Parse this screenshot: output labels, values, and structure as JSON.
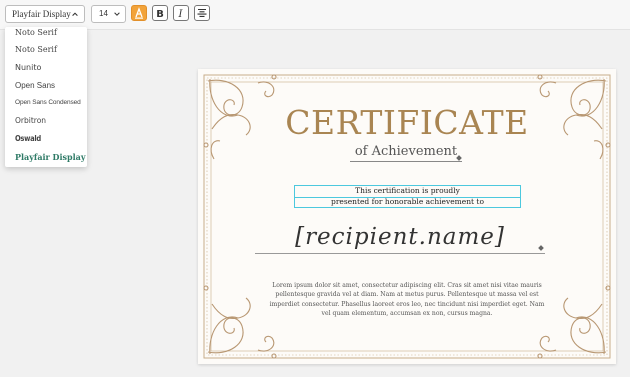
{
  "toolbar": {
    "font_select": {
      "value": "Playfair Display",
      "icon": "chevron-up-icon"
    },
    "size_select": {
      "value": "14",
      "icon": "chevron-down-icon"
    },
    "buttons": {
      "text_color": {
        "icon": "text-color-icon",
        "label": "A",
        "color": "#f2a33a"
      },
      "bold": {
        "icon": "bold-icon",
        "label": "B"
      },
      "italic": {
        "icon": "italic-icon",
        "label": "I"
      },
      "align": {
        "icon": "align-center-icon"
      }
    }
  },
  "font_dropdown": {
    "items": [
      "Noto Serif",
      "Noto Serif",
      "Nunito",
      "Open Sans",
      "Open Sans Condensed",
      "Orbitron",
      "Oswald",
      "Playfair Display"
    ],
    "selected": "Playfair Display",
    "selected_color": "#2e7a66"
  },
  "certificate": {
    "title": "CERTIFICATE",
    "subtitle": "of Achievement",
    "statement_line1": "This certification is proudly",
    "statement_line2": "presented for honorable achievement to",
    "recipient": "[recipient.name]",
    "body": "Lorem ipsum dolor sit amet, consectetur adipiscing elit. Cras sit amet nisi vitae mauris pellentesque gravida vel at diam. Nam at metus purus. Pellentesque ut massa vel est imperdiet consectetur. Phasellus laoreet eros leo, nec tincidunt nisi imperdiet eget. Nam vel quam elementum, accumsan ex non, cursus magna.",
    "accent_color": "#a98552",
    "ornament_color": "#b89772"
  }
}
